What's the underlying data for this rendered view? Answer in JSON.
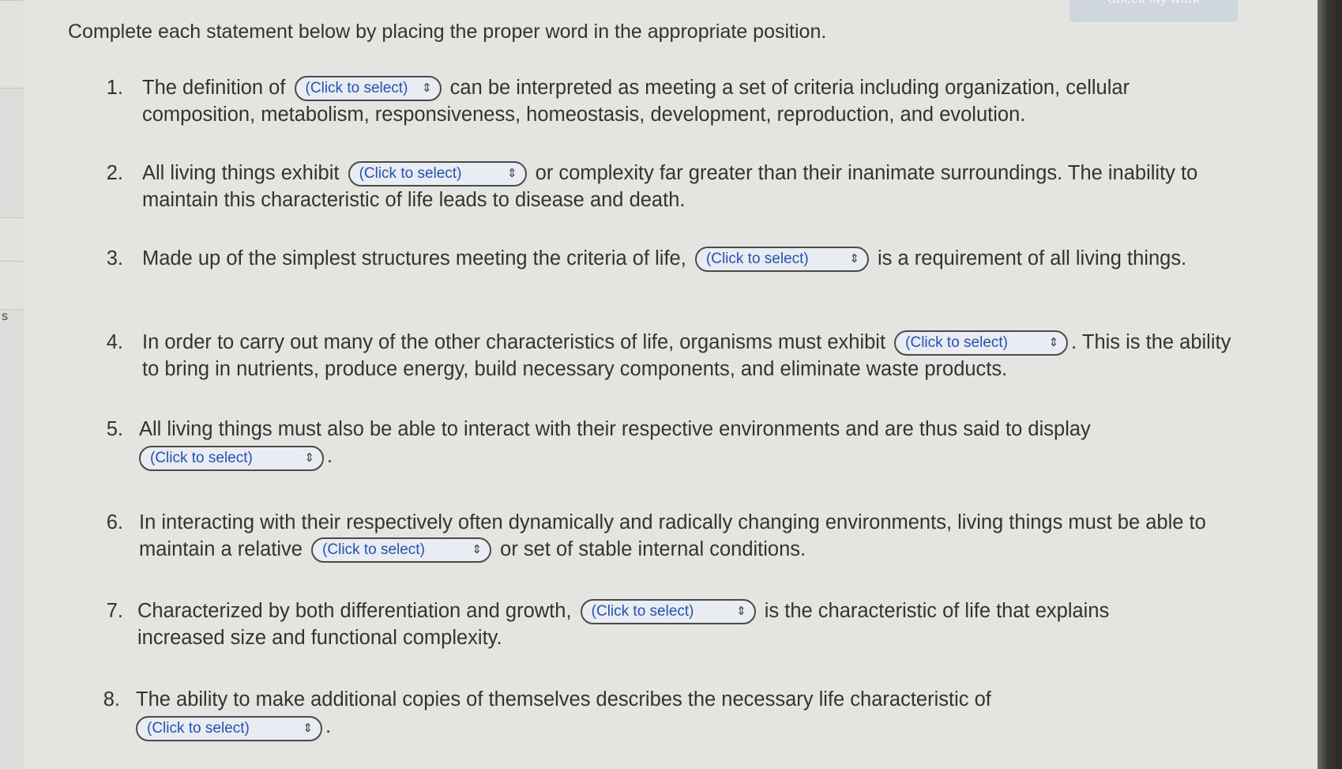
{
  "header": {
    "check_button_label": "Check my work",
    "instructions": "Complete each statement below by placing the proper word in the appropriate position."
  },
  "sidebar": {
    "letter": "s"
  },
  "select_placeholder": "(Click to select)",
  "select_chevron_icon": "up-down-chevron-icon",
  "questions": [
    {
      "number": "1.",
      "before": "The definition of",
      "after": "can be interpreted as meeting a set of criteria including organization, cellular composition, metabolism, responsiveness, homeostasis, development, reproduction, and evolution."
    },
    {
      "number": "2.",
      "before": "All living things exhibit",
      "after": "or complexity far greater than their inanimate surroundings. The inability to maintain this characteristic of life leads to disease and death."
    },
    {
      "number": "3.",
      "before": "Made up of the simplest structures meeting the criteria of life,",
      "after": "is a requirement of all living things."
    },
    {
      "number": "4.",
      "before": "In order to carry out many of the other characteristics of life, organisms must exhibit",
      "after": ". This is the ability to bring in nutrients, produce energy, build necessary components, and eliminate waste products."
    },
    {
      "number": "5.",
      "before": "All living things must also be able to interact with their respective environments and are thus said to display",
      "after": "."
    },
    {
      "number": "6.",
      "before": "In interacting with their respectively often dynamically and radically changing environments, living things must be able to maintain a relative",
      "after": "or set of stable internal conditions."
    },
    {
      "number": "7.",
      "before": "Characterized by both differentiation and growth,",
      "after": "is the characteristic of life that explains increased size and functional complexity."
    },
    {
      "number": "8.",
      "before": "The ability to make additional copies of themselves describes the necessary life characteristic of",
      "after": "."
    }
  ]
}
